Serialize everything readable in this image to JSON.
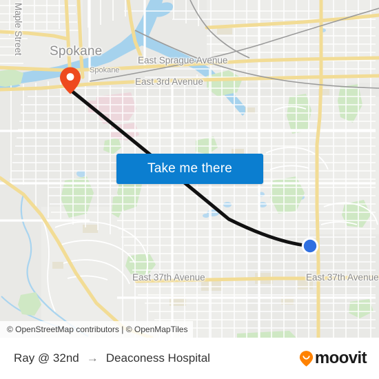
{
  "map": {
    "attribution": "© OpenStreetMap contributors | © OpenMapTiles",
    "labels": {
      "city_big": "Spokane",
      "city_small": "Spokane",
      "maple_street": "Maple Street",
      "sprague_avenue": "East Sprague Avenue",
      "third_avenue": "East 3rd Avenue",
      "thirty_seventh_left": "East 37th Avenue",
      "thirty_seventh_right": "East 37th Avenue"
    },
    "colors": {
      "land": "#e9e9e6",
      "water": "#a5d2ed",
      "park": "#cfe8c4",
      "arterial": "#f7e4a0",
      "street": "#ffffff",
      "route_line": "#111111",
      "marker": "#ee4a1e",
      "origin_dot": "#2f6fe0",
      "button_blue": "#0b7ed0"
    }
  },
  "button": {
    "label": "Take me there"
  },
  "footer": {
    "origin": "Ray @ 32nd",
    "arrow": "→",
    "destination": "Deaconess Hospital",
    "brand_name": "moovit",
    "brand_color": "#ff8200"
  }
}
